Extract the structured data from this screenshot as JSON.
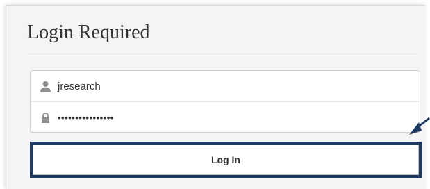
{
  "form": {
    "title": "Login Required",
    "username": {
      "value": "jresearch",
      "icon": "user-icon"
    },
    "password": {
      "masked_value": "••••••••••••••••",
      "icon": "lock-icon"
    },
    "login_button_label": "Log In"
  },
  "colors": {
    "highlight_frame": "#1f3b64",
    "panel_background": "#f4f4f4",
    "arrow": "#1f3b64"
  },
  "annotation": {
    "arrow_icon": "arrow-pointer-icon"
  }
}
